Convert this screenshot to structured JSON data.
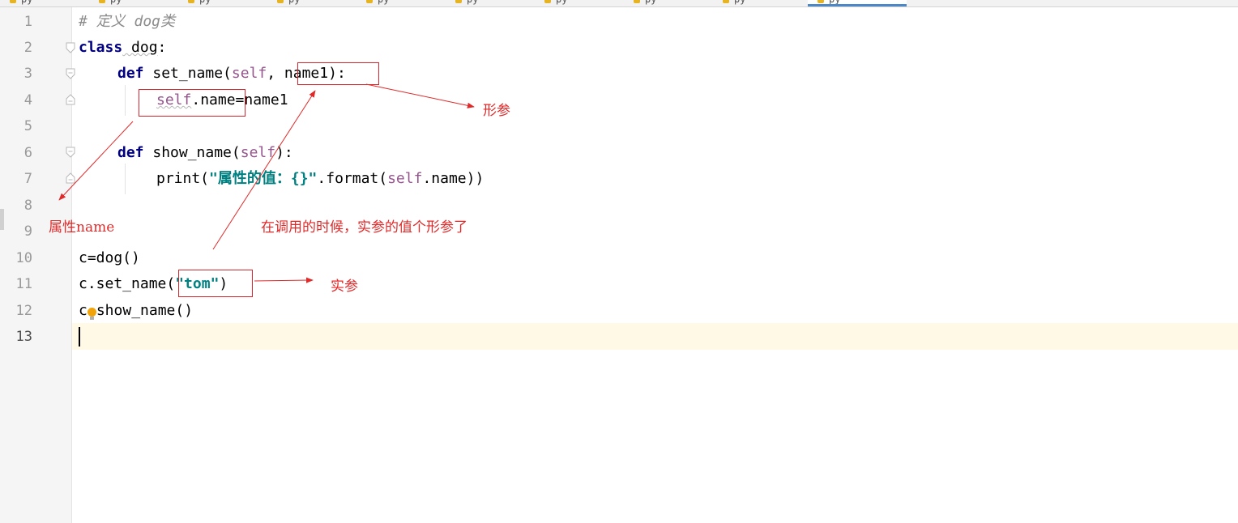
{
  "tabs": [
    {
      "label": "py",
      "active": false
    },
    {
      "label": "py",
      "active": false
    },
    {
      "label": "py",
      "active": false
    },
    {
      "label": "py",
      "active": false
    },
    {
      "label": "py",
      "active": false
    },
    {
      "label": "py",
      "active": false
    },
    {
      "label": "py",
      "active": false
    },
    {
      "label": "py",
      "active": false
    },
    {
      "label": "py",
      "active": false
    },
    {
      "label": "py",
      "active": true
    }
  ],
  "editor": {
    "line_numbers": [
      "1",
      "2",
      "3",
      "4",
      "5",
      "6",
      "7",
      "8",
      "9",
      "10",
      "11",
      "12",
      "13"
    ],
    "current_line": "13",
    "code": {
      "l1_comment": "# 定义 dog类",
      "l2_kw": "class",
      "l2_name": " dog",
      "l2_colon": ":",
      "l3_kw": "def",
      "l3_fn": " set_name(",
      "l3_self": "self",
      "l3_rest": ", name1):",
      "l4_self": "self",
      "l4_rest": ".name=name1",
      "l6_kw": "def",
      "l6_fn": " show_name(",
      "l6_self": "self",
      "l6_rest": "):",
      "l7_print": "print(",
      "l7_str": "\"属性的值：{}\"",
      "l7_mid": ".format(",
      "l7_self": "self",
      "l7_end": ".name))",
      "l10": "c=dog()",
      "l11_pre": "c.set_name(",
      "l11_str": "\"tom\"",
      "l11_post": ")",
      "l12_pre": "c",
      "l12_post": "show_name()"
    }
  },
  "annotations": {
    "formal_param": "形参",
    "attribute_name": "属性name",
    "call_note": "在调用的时候，实参的值个形参了",
    "actual_param": "实参"
  },
  "colors": {
    "annotation_red": "#e02a2a",
    "keyword": "#000080",
    "self": "#94558d",
    "string": "#008080",
    "current_line": "#fff9e5",
    "active_tab_underline": "#4a88c7"
  }
}
